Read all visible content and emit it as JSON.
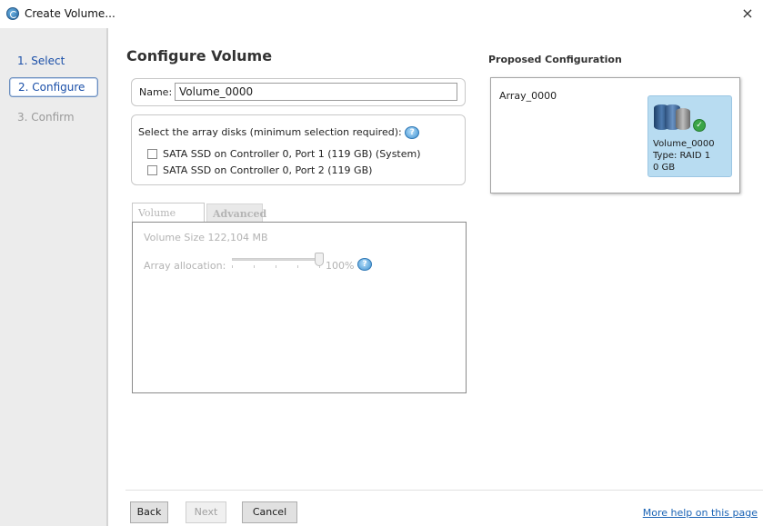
{
  "window": {
    "title": "Create Volume...",
    "close_glyph": "×",
    "app_icon": "app-icon"
  },
  "steps": [
    {
      "label": "1. Select",
      "state": "done"
    },
    {
      "label": "2. Configure",
      "state": "active"
    },
    {
      "label": "3. Confirm",
      "state": "disabled"
    }
  ],
  "main": {
    "title": "Configure Volume",
    "name_label": "Name:",
    "name_value": "Volume_0000",
    "disks_header": "Select the array disks (minimum selection required):",
    "disks": [
      {
        "label": "SATA SSD on Controller 0, Port 1 (119 GB) (System)",
        "checked": false
      },
      {
        "label": "SATA SSD on Controller 0, Port 2 (119 GB)",
        "checked": false
      }
    ],
    "tabs": [
      "Volume Size",
      "Advanced"
    ],
    "volume_size_text": "Volume Size 122,104 MB",
    "array_allocation_label": "Array allocation:",
    "array_allocation_value": "100%"
  },
  "proposed": {
    "title": "Proposed Configuration",
    "array_name": "Array_0000",
    "volume": {
      "name": "Volume_0000",
      "type": "Type: RAID 1",
      "size": "0 GB"
    }
  },
  "footer": {
    "back": "Back",
    "next": "Next",
    "cancel": "Cancel",
    "help_link": "More help on this page"
  },
  "colors": {
    "step_active": "#1a4fa8",
    "step_disabled": "#9a9a9a",
    "volume_card_bg": "#b8dcf1",
    "link": "#1a63b5"
  }
}
